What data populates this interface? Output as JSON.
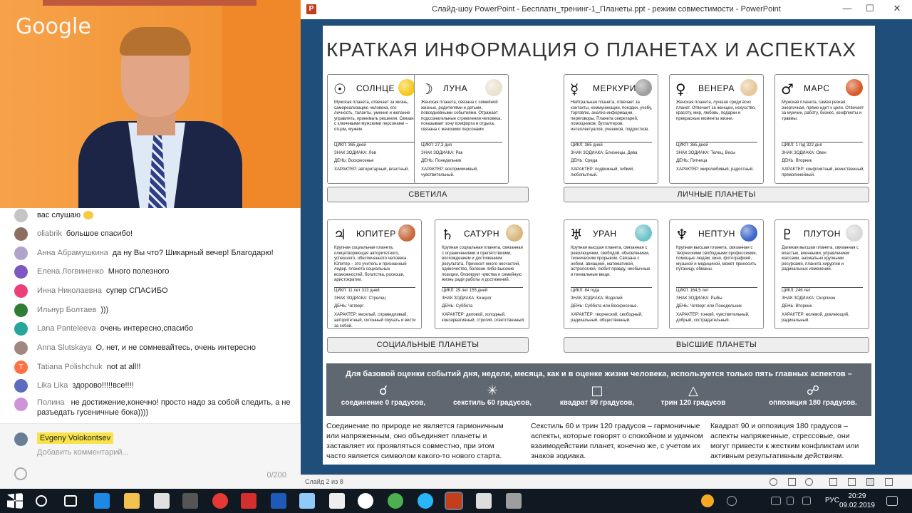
{
  "webcam": {
    "logo": "Google"
  },
  "chat": {
    "messages": [
      {
        "author": "",
        "text": "вас слушаю",
        "avatar_color": "#9e9e9e"
      },
      {
        "author": "oliabrik",
        "text": "большое спасибо!",
        "avatar_color": "#8d6e63"
      },
      {
        "author": "Анна Абрамушкина",
        "text": "да ну Вы что? Шикарный вечер! Благодарю!",
        "avatar_color": "#b0a4c8"
      },
      {
        "author": "Елена Логвиненко",
        "text": "Много полезного",
        "avatar_color": "#7e57c2"
      },
      {
        "author": "Инна Николаевна",
        "text": "супер СПАСИБО",
        "avatar_color": "#ec407a"
      },
      {
        "author": "Ильнур Болтаев",
        "text": ")))",
        "avatar_color": "#2e7d32"
      },
      {
        "author": "Lana Panteleeva",
        "text": "очень интересно,спасибо",
        "avatar_color": "#26a69a"
      },
      {
        "author": "Anna Slutskaya",
        "text": "О, нет, и не сомневайтесь, очень интересно",
        "avatar_color": "#a1887f"
      },
      {
        "author": "Tatiana Polishchuk",
        "text": "not at all!!",
        "avatar_color": "#ff7043",
        "initial": "T"
      },
      {
        "author": "Lika Lika",
        "text": "здорово!!!!!все!!!!",
        "avatar_color": "#5c6bc0"
      },
      {
        "author": "Полина",
        "text": "не достижение,конечно! просто надо за собой следить, а не разъедать гусеничные бока))))",
        "avatar_color": "#ce93d8"
      }
    ],
    "composer": {
      "user": "Evgeny Volokontsev",
      "placeholder": "Добавить комментарий...",
      "counter": "0/200"
    }
  },
  "window": {
    "title": "Слайд-шоу PowerPoint - Бесплатн_тренинг-1_Планеты.ppt - режим совместимости - PowerPoint",
    "app_icon": "P",
    "minimize": "—",
    "maximize": "☐",
    "close": "✕"
  },
  "status": {
    "slide_indicator": "Слайд 2 из 8"
  },
  "slide": {
    "title": "КРАТКАЯ ИНФОРМАЦИЯ О ПЛАНЕТАХ И АСПЕКТАХ",
    "labels": {
      "cycle": "ЦИКЛ:",
      "sign": "ЗНАК ЗОДИАКА:",
      "day": "ДЕНЬ:",
      "character": "ХАРАКТЕР:"
    },
    "planets": [
      {
        "symbol": "☉",
        "name": "СОЛНЦЕ",
        "color": "#f6c81a",
        "desc": "Мужская планета, отвечает за жизнь, самореализацию человека, его личность, таланты, умение и желание управлять, принимать решения. Связана с ключевыми мужскими персонами – отцом, мужем.",
        "cycle": "365 дней",
        "sign": "Лев",
        "day": "Воскресенье",
        "character": "авторитарный, властный."
      },
      {
        "symbol": "☽",
        "name": "ЛУНА",
        "color": "#e8e2cf",
        "desc": "Женская планета, связана с семейной жизнью, родителями и детьми, повседневными событиями. Отражает подсознательные стремления человека, показывает зону комфорта и отдыха, связана с женскими персонами.",
        "cycle": "27,3 дня",
        "sign": "Рак",
        "day": "Понедельник",
        "character": "восприимчивый, чувствительный."
      },
      {
        "symbol": "☿",
        "name": "МЕРКУРИЙ",
        "color": "#9e9e9e",
        "desc": "Нейтральная планета, отвечает за контакты, коммуникации, поездки, учебу, торговлю, анализ информации, переговоры. Планета секретарей, помощников, бухгалтеров, интеллектуалов, учеников, подростков.",
        "cycle": "365 дней",
        "sign": "Близнецы, Дева",
        "day": "Среда",
        "character": "подвижный, гибкий, любопытный."
      },
      {
        "symbol": "♀",
        "name": "ВЕНЕРА",
        "color": "#e8c79a",
        "desc": "Женская планета, лучшая среди всех планет. Отвечает за женщин, искусство, красоту, мир, любовь, подарки и прекрасные моменты жизни.",
        "cycle": "365 дней",
        "sign": "Телец, Весы",
        "day": "Пятница",
        "character": "миролюбивый, радостный."
      },
      {
        "symbol": "♂",
        "name": "МАРС",
        "color": "#d65a2a",
        "desc": "Мужская планета, самая резкая, энергичная, прямо идет к цели. Отвечает за мужчин, работу, бизнес, конфликты и травмы.",
        "cycle": "1 год 322 дня",
        "sign": "Овен",
        "day": "Вторник",
        "character": "конфликтный, воинственный, прямолинейный."
      },
      {
        "symbol": "♃",
        "name": "ЮПИТЕР",
        "color": "#c9693b",
        "desc": "Крупная социальная планета, олицетворяющая авторитетного, успешного, обеспеченного человека. Юпитер – это учитель и признанный лидер, планета социальных возможностей, богатства, роскоши, аристократии.",
        "cycle": "11 лет 313 дней",
        "sign": "Стрелец",
        "day": "Четверг",
        "character": "веселый, справедливый, авторитетный, склонный поучать и вести за собой."
      },
      {
        "symbol": "♄",
        "name": "САТУРН",
        "color": "#d9b77c",
        "desc": "Крупная социальная планета, связанная с ограничениями и препятствиями, восхождением и достижением результата. Приносит много несчастий, одиночество, болезни либо высокие позиции, блокирует чувства и семейную жизнь ради работы и достижений.",
        "cycle": "29 лет 155 дней",
        "sign": "Козерог",
        "day": "Суббота",
        "character": "деловой, холодный, консервативный, строгий, ответственный."
      },
      {
        "symbol": "♅",
        "name": "УРАН",
        "color": "#6fc3c9",
        "desc": "Крупная высшая планета, связанная с революциями, свободой, обновлением, техническим прорывом. Связана с небом, авиацией, математикой, астрологией, любит правду, необычные и гениальные вещи.",
        "cycle": "84 года",
        "sign": "Водолей",
        "day": "Суббота или Воскресенье.",
        "character": "творческий, свободный, радикальный, общественный."
      },
      {
        "symbol": "♆",
        "name": "НЕПТУН",
        "color": "#3f67c9",
        "desc": "Крупная высшая планета, связанная с творческими свободными профессиями, помощью людям, кино, фотографией, музыкой и медициной, может приносить путаницу, обманы.",
        "cycle": "164,5 лет",
        "sign": "Рыбы",
        "day": "Четверг или Понедельник",
        "character": "тонкий, чувствительный, добрый, сострадательный."
      },
      {
        "symbol": "♇",
        "name": "ПЛУТОН",
        "color": "#d8d8d8",
        "desc": "Далекая высшая планета, связанная с властью, военными, управлением массами, аномально крупными ресурсами, планета хирургии и радикальных изменений.",
        "cycle": "246 лет",
        "sign": "Скорпион",
        "day": "Вторник.",
        "character": "волевой, довлеющий, радикальный."
      }
    ],
    "groups": [
      "СВЕТИЛА",
      "ЛИЧНЫЕ ПЛАНЕТЫ",
      "СОЦИАЛЬНЫЕ ПЛАНЕТЫ",
      "ВЫСШИЕ ПЛАНЕТЫ"
    ],
    "aspects_intro": "Для базовой оценки событий дня, недели, месяца, как и в оценке жизни человека, используется только пять главных аспектов –",
    "aspects": [
      {
        "symbol": "☌",
        "label": "соединение 0 градусов,"
      },
      {
        "symbol": "✳",
        "label": "секстиль 60 градусов,"
      },
      {
        "symbol": "□",
        "label": "квадрат 90 градусов,"
      },
      {
        "symbol": "△",
        "label": "трин 120 градусов"
      },
      {
        "symbol": "☍",
        "label": "оппозиция 180 градусов."
      }
    ],
    "footer": [
      "Соединение по природе не является гармоничным или напряженным, оно объединяет планеты и заставляет их проявляться совместно, при этом часто является символом какого-то нового старта.",
      "Секстиль 60 и трин 120 градусов – гармоничные аспекты, которые говорят о спокойном и удачном взаимодействии планет, конечно же, с учетом их знаков зодиака.",
      "Квадрат 90 и оппозиция 180 градусов – аспекты напряженные, стрессовые, они могут привести к жестким конфликтам или активным результативным действиям."
    ]
  },
  "taskbar": {
    "lang": "РУС",
    "time": "20:29",
    "date": "09.02.2019"
  }
}
